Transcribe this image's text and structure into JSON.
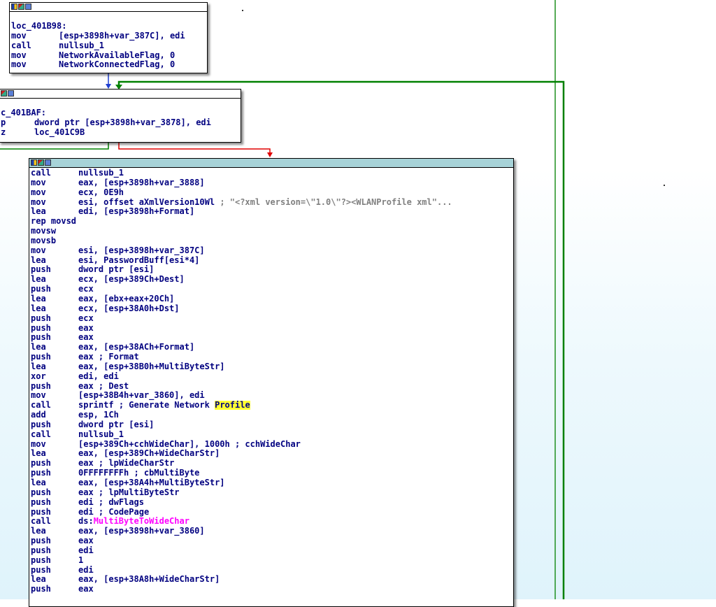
{
  "colors": {
    "mnemonic": "#000080",
    "operand_blue": "#000080",
    "operand_green": "#008000",
    "comment_grey": "#808080",
    "import_pink": "#ff00ff",
    "highlight": "#ffff33",
    "edge_green": "#008000",
    "edge_blue": "#1f3fd0",
    "edge_red": "#e00000",
    "title_teal": "#a7d3d8"
  },
  "block1": {
    "label": "loc_401B98:",
    "lines": [
      {
        "m": "mov",
        "o": "[esp+3898h+var_387C], edi"
      },
      {
        "m": "call",
        "o": "nullsub_1"
      },
      {
        "m": "mov",
        "o": "NetworkAvailableFlag, 0"
      },
      {
        "m": "mov",
        "o": "NetworkConnectedFlag, 0"
      }
    ]
  },
  "block2": {
    "label": "c_401BAF:",
    "lines": [
      {
        "m": "p",
        "o": "dword ptr [esp+3898h+var_3878], edi"
      },
      {
        "m": "z",
        "o": "loc_401C9B"
      }
    ]
  },
  "block3": {
    "lines": [
      {
        "m": "call",
        "o": "nullsub_1"
      },
      {
        "m": "mov",
        "o": "eax, [esp+3898h+var_3888]"
      },
      {
        "m": "mov",
        "o": "ecx, 0E9h"
      },
      {
        "m": "mov",
        "o": "esi, offset aXmlVersion10Wl",
        "c": "; \"<?xml version=\\\"1.0\\\"?><WLANProfile xml\"..."
      },
      {
        "m": "lea",
        "o": "edi, [esp+3898h+Format]"
      },
      {
        "m": "rep movsd",
        "o": ""
      },
      {
        "m": "movsw",
        "o": ""
      },
      {
        "m": "movsb",
        "o": ""
      },
      {
        "m": "mov",
        "o": "esi, [esp+3898h+var_387C]"
      },
      {
        "m": "lea",
        "o": "esi, PasswordBuff[esi*4]"
      },
      {
        "m": "push",
        "o": "dword ptr [esi]"
      },
      {
        "m": "lea",
        "o": "ecx, [esp+389Ch+Dest]"
      },
      {
        "m": "push",
        "o": "ecx"
      },
      {
        "m": "lea",
        "o": "eax, [ebx+eax+20Ch]"
      },
      {
        "m": "lea",
        "o": "ecx, [esp+38A0h+Dst]"
      },
      {
        "m": "push",
        "o": "ecx"
      },
      {
        "m": "push",
        "o": "eax"
      },
      {
        "m": "push",
        "o": "eax"
      },
      {
        "m": "lea",
        "o": "eax, [esp+38ACh+Format]"
      },
      {
        "m": "push",
        "o": "eax",
        "c": "; Format"
      },
      {
        "m": "lea",
        "o": "eax, [esp+38B0h+MultiByteStr]"
      },
      {
        "m": "xor",
        "o": "edi, edi"
      },
      {
        "m": "push",
        "o": "eax",
        "c": "; Dest"
      },
      {
        "m": "mov",
        "o": "[esp+38B4h+var_3860], edi"
      },
      {
        "m": "call",
        "o": "sprintf",
        "c": "; Generate Network ",
        "hl": "Profile"
      },
      {
        "m": "add",
        "o": "esp, 1Ch"
      },
      {
        "m": "push",
        "o": "dword ptr [esi]"
      },
      {
        "m": "call",
        "o": "nullsub_1"
      },
      {
        "m": "mov",
        "o": "[esp+389Ch+cchWideChar], 1000h",
        "c": "; cchWideChar"
      },
      {
        "m": "lea",
        "o": "eax, [esp+389Ch+WideCharStr]"
      },
      {
        "m": "push",
        "o": "eax",
        "c": "; lpWideCharStr"
      },
      {
        "m": "push",
        "o": "0FFFFFFFFh",
        "c": "; cbMultiByte"
      },
      {
        "m": "lea",
        "o": "eax, [esp+38A4h+MultiByteStr]"
      },
      {
        "m": "push",
        "o": "eax",
        "c": "; lpMultiByteStr"
      },
      {
        "m": "push",
        "o": "edi",
        "c": "; dwFlags"
      },
      {
        "m": "push",
        "o": "edi",
        "c": "; CodePage"
      },
      {
        "m": "call",
        "o": "ds:",
        "pink": "MultiByteToWideChar"
      },
      {
        "m": "lea",
        "o": "eax, [esp+3898h+var_3860]"
      },
      {
        "m": "push",
        "o": "eax"
      },
      {
        "m": "push",
        "o": "edi"
      },
      {
        "m": "push",
        "o": "1"
      },
      {
        "m": "push",
        "o": "edi"
      },
      {
        "m": "lea",
        "o": "eax, [esp+38A8h+WideCharStr]"
      },
      {
        "m": "push",
        "o": "eax"
      }
    ]
  }
}
